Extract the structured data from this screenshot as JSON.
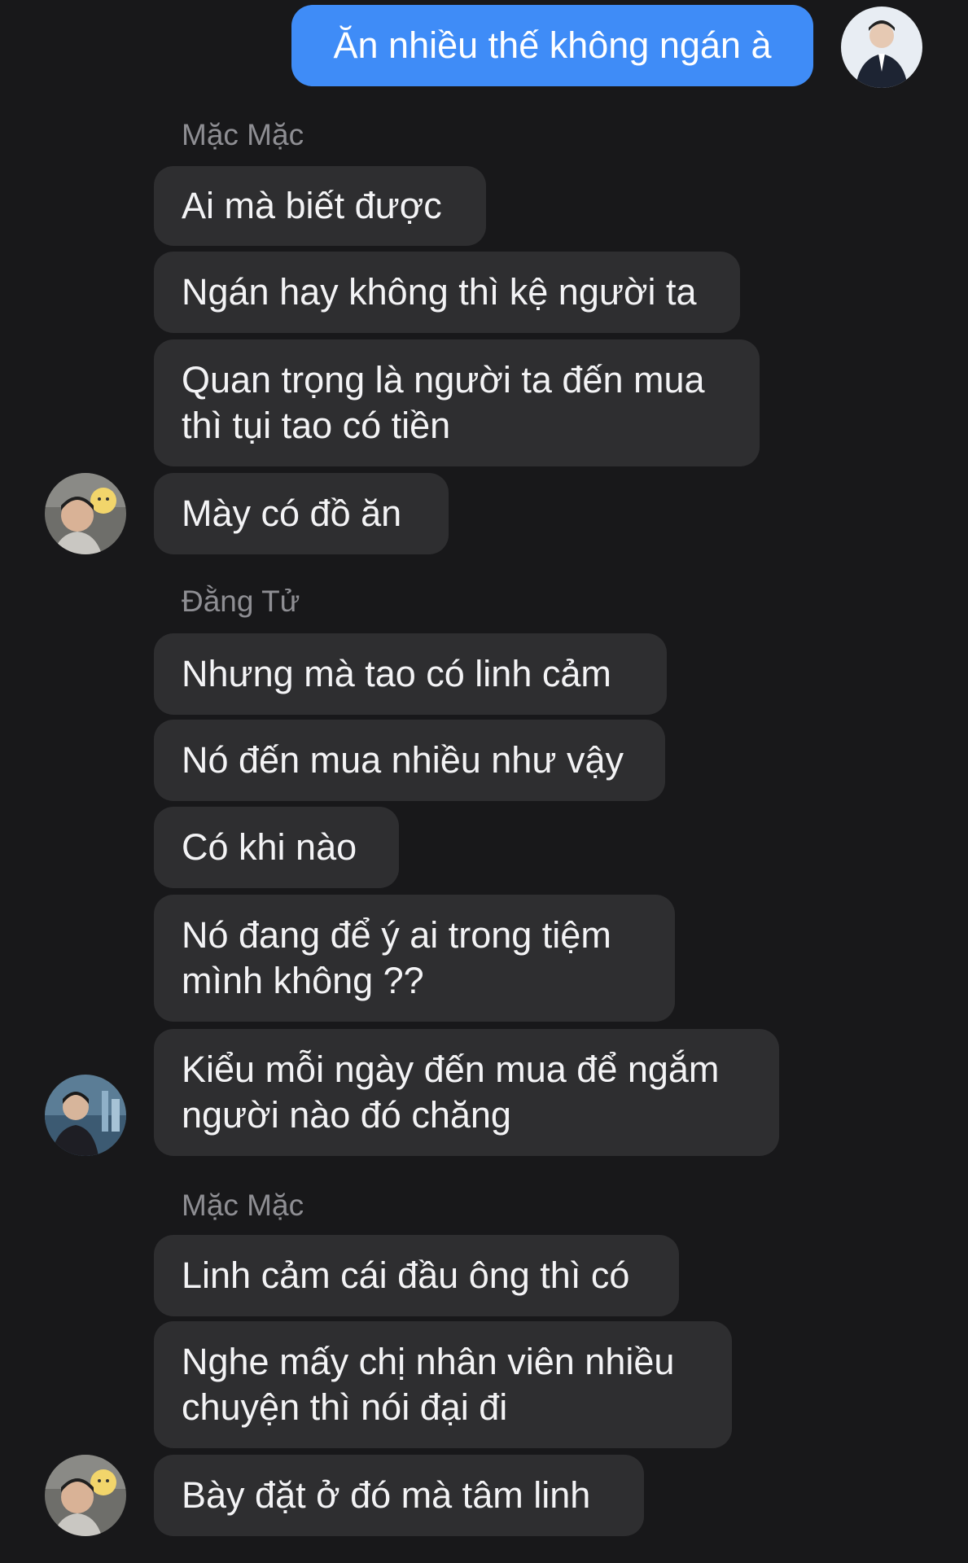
{
  "colors": {
    "background": "#18181a",
    "incoming_bubble": "#2e2e30",
    "outgoing_bubble": "#3f8cf7",
    "sender_name": "#8e8e93",
    "text": "#f3f3f5"
  },
  "messages": {
    "out_1": "Ăn nhiều thế không ngán à",
    "sender_1": "Mặc Mặc",
    "m1": "Ai mà biết được",
    "m2": "Ngán hay không thì kệ người ta",
    "m3": "Quan trọng là người ta đến mua\nthì tụi tao có tiền",
    "m4": "Mày có đồ ăn",
    "sender_2": "Đằng Tử",
    "m5": "Nhưng mà tao có linh cảm",
    "m6": "Nó đến mua nhiều như vậy",
    "m7": "Có khi nào",
    "m8": "Nó đang để ý ai trong tiệm\nmình không ??",
    "m9": "Kiểu mỗi ngày đến mua để ngắm\nngười nào đó chăng",
    "sender_3": "Mặc Mặc",
    "m10": "Linh cảm cái đầu ông thì có",
    "m11": "Nghe mấy chị nhân viên nhiều\nchuyện thì nói đại đi",
    "m12": "Bày đặt ở đó mà tâm linh"
  },
  "avatars": {
    "me": "avatar-me-icon",
    "mac_mac": "avatar-mac-mac-icon",
    "dang_tu": "avatar-dang-tu-icon"
  }
}
